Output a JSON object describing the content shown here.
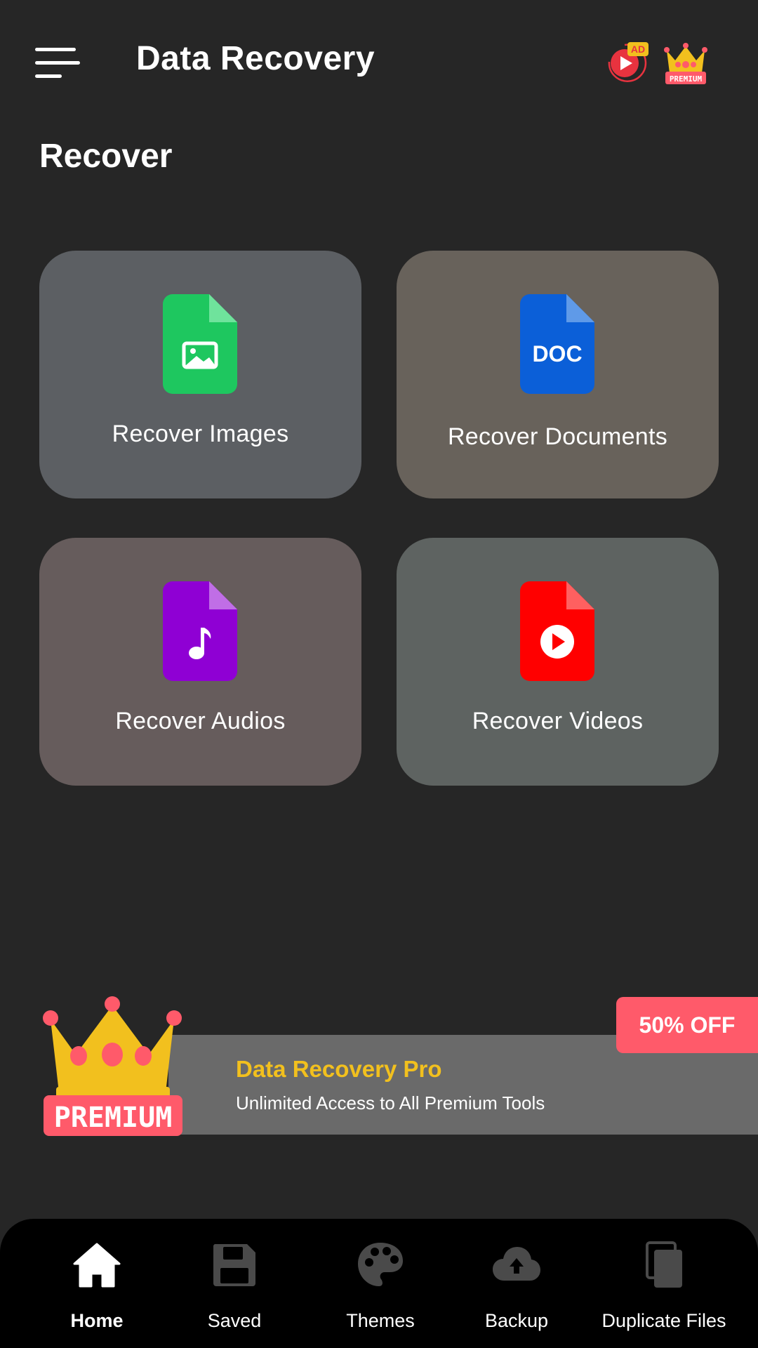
{
  "app_bar": {
    "title": "Data Recovery",
    "menu_icon": "hamburger-menu-icon",
    "ad_icon": "video-ad-icon",
    "ad_badge": "AD",
    "premium_icon": "premium-crown-icon",
    "premium_badge": "PREMIUM"
  },
  "section": {
    "title": "Recover"
  },
  "cards": [
    {
      "label": "Recover Images",
      "icon": "image-file-icon",
      "color": "#1ec75f"
    },
    {
      "label": "Recover Documents",
      "icon": "doc-file-icon",
      "icon_text": "DOC",
      "color": "#0b5fd8"
    },
    {
      "label": "Recover Audios",
      "icon": "audio-file-icon",
      "color": "#8f00d4"
    },
    {
      "label": "Recover Videos",
      "icon": "video-file-icon",
      "color": "#ff0000"
    }
  ],
  "promo": {
    "title": "Data Recovery Pro",
    "subtitle": "Unlimited Access to All Premium Tools",
    "badge": "50% OFF",
    "crown_label": "PREMIUM",
    "title_color": "#f2c01e",
    "badge_color": "#ff5a6a"
  },
  "bottom_nav": {
    "items": [
      {
        "label": "Home",
        "icon": "home-icon",
        "active": true
      },
      {
        "label": "Saved",
        "icon": "save-icon",
        "active": false
      },
      {
        "label": "Themes",
        "icon": "palette-icon",
        "active": false
      },
      {
        "label": "Backup",
        "icon": "cloud-upload-icon",
        "active": false
      },
      {
        "label": "Duplicate Files",
        "icon": "copy-files-icon",
        "active": false
      }
    ]
  }
}
